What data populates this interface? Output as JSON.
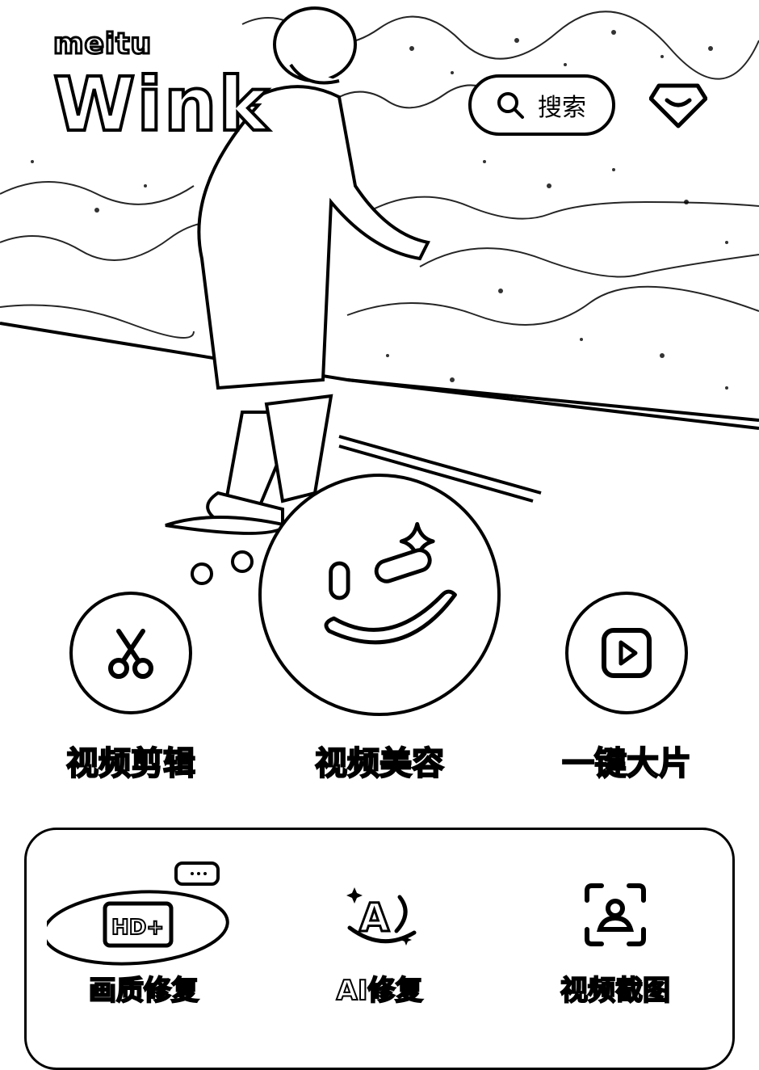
{
  "header": {
    "brand_small": "meitu",
    "brand_big": "Wink",
    "search_label": "搜索"
  },
  "main_actions": [
    {
      "label": "视频剪辑",
      "icon": "scissors-icon"
    },
    {
      "label": "视频美容",
      "icon": "wink-face-icon"
    },
    {
      "label": "一键大片",
      "icon": "play-icon"
    }
  ],
  "tools": [
    {
      "label": "画质修复",
      "icon": "hd-plus-icon",
      "badge": "hot-badge"
    },
    {
      "label": "AI修复",
      "icon": "ai-sparkle-icon"
    },
    {
      "label": "视频截图",
      "icon": "screenshot-person-icon"
    }
  ]
}
